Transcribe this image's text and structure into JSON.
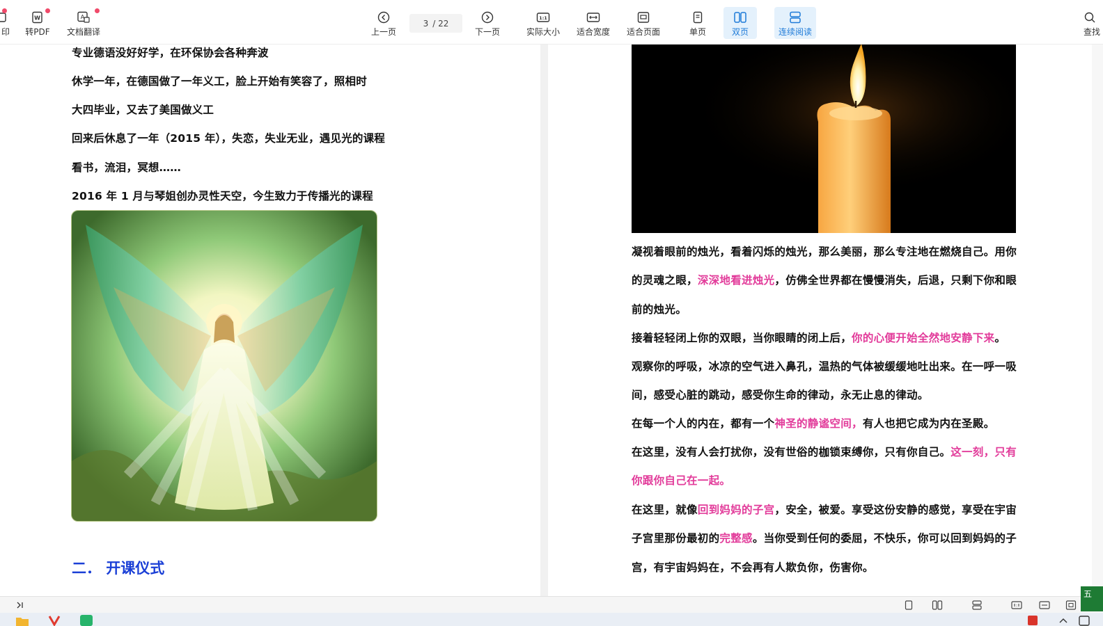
{
  "toolbar": {
    "print_label": "印",
    "to_pdf_label": "转PDF",
    "translate_label": "文档翻译",
    "prev_label": "上一页",
    "current_page": "3",
    "total_pages": "/ 22",
    "next_label": "下一页",
    "actual_size_label": "实际大小",
    "fit_width_label": "适合宽度",
    "fit_page_label": "适合页面",
    "single_page_label": "单页",
    "double_page_label": "双页",
    "continuous_label": "连续阅读",
    "search_label": "查找",
    "accent_color": "#1d7ad8",
    "badge_color": "#f04a6a"
  },
  "left_page": {
    "lines": [
      "专业德语没好好学，在环保协会各种奔波",
      "休学一年，在德国做了一年义工，脸上开始有笑容了，照相时",
      "大四毕业，又去了美国做义工",
      "回来后休息了一年（2015 年），失恋，失业无业，遇见光的课程",
      "看书，流泪，冥想……",
      "2016 年 1 月与琴姐创办灵性天空，今生致力于传播光的课程"
    ],
    "section_title": "二． 开课仪式"
  },
  "right_page": {
    "p1_a": "凝视着眼前的烛光，看着闪烁的烛光，那么美丽，那么专注地在燃烧自己。用你的灵魂之眼，",
    "p1_hl": "深深地看进烛光",
    "p1_b": "，仿佛全世界都在慢慢消失，后退，只剩下你和眼前的烛光。",
    "p2_a": "接着轻轻闭上你的双眼，当你眼睛的闭上后，",
    "p2_hl": "你的心便开始全然地安静下来",
    "p2_b": "。",
    "p3": "观察你的呼吸，冰凉的空气进入鼻孔，温热的气体被缓缓地吐出来。在一呼一吸间，感受心脏的跳动，感受你生命的律动，永无止息的律动。",
    "p4_a": "在每一个人的内在，都有一个",
    "p4_hl": "神圣的静谧空间，",
    "p4_b": "有人也把它成为内在圣殿。",
    "p5_a": "在这里，没有人会打扰你，没有世俗的枷锁束缚你，只有你自己。",
    "p5_hl": "这一刻，只有你跟你自己在一起。",
    "p6_a": "在这里，就像",
    "p6_hl1": "回到妈妈的子宫",
    "p6_b": "，安全，被爱。享受这份安静的感觉，享受在宇宙子宫里那份最初的",
    "p6_hl2": "完整感",
    "p6_c": "。当你受到任何的委屈，不快乐，你可以回到妈妈的子宫，有宇宙妈妈在，不会再有人欺负你，伤害你。",
    "highlight_color": "#e23b9a"
  },
  "ime": {
    "label": "五"
  }
}
